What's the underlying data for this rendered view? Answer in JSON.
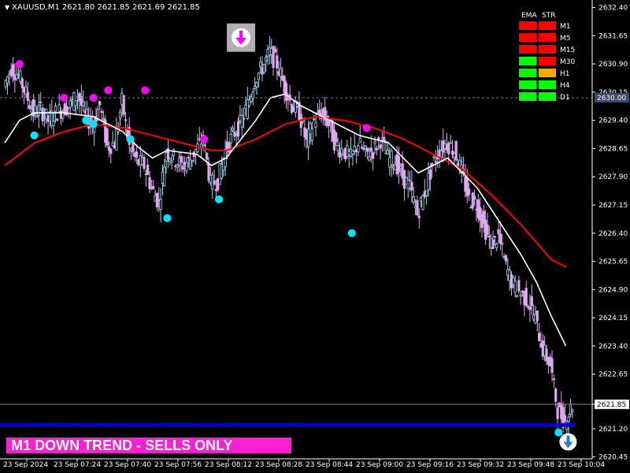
{
  "header": {
    "symbol_timeframe": "XAUUSD,M1",
    "ohlc": "2621.80 2621.85 2621.69 2621.85"
  },
  "banner": {
    "text": "M1  DOWN TREND - SELLS ONLY",
    "color": "#ff1fd2"
  },
  "strength_panel": {
    "headers": [
      "EMA",
      "STR"
    ],
    "rows": [
      {
        "tf": "M1",
        "ema": "#ff0000",
        "str": "#ff0000"
      },
      {
        "tf": "M5",
        "ema": "#ff0000",
        "str": "#ff0000"
      },
      {
        "tf": "M15",
        "ema": "#ff0000",
        "str": "#ff0000"
      },
      {
        "tf": "M30",
        "ema": "#00ff00",
        "str": "#ff0000"
      },
      {
        "tf": "H1",
        "ema": "#00ff00",
        "str": "#ffa500"
      },
      {
        "tf": "H4",
        "ema": "#00ff00",
        "str": "#00ff00"
      },
      {
        "tf": "D1",
        "ema": "#00ff00",
        "str": "#00ff00"
      }
    ]
  },
  "price_tags": {
    "dashed_level": "2630.00",
    "current": "2621.85"
  },
  "colors": {
    "bull_bar": "#a8d8f0",
    "bear_bar": "#e0a8f0",
    "fast_ema": "#ffffff",
    "slow_ema": "#ff0000",
    "swing_high_marker": "#ff00ff",
    "swing_low_marker": "#00e5ff",
    "baseline": "#0000cc",
    "sell_signal_bg": "#b0b0b0",
    "sell_signal_arrow": "#ff00ff"
  },
  "chart_data": {
    "type": "candlestick",
    "ylim": [
      2620.4,
      2632.6
    ],
    "yticks": [
      "2632.40",
      "2631.65",
      "2630.90",
      "2630.15",
      "2629.40",
      "2628.65",
      "2627.90",
      "2627.15",
      "2626.40",
      "2625.65",
      "2624.90",
      "2624.15",
      "2623.40",
      "2622.65",
      "2621.85",
      "2621.20",
      "2620.45"
    ],
    "xticks": [
      "23 Sep 2024",
      "23 Sep 07:24",
      "23 Sep 07:40",
      "23 Sep 07:56",
      "23 Sep 08:12",
      "23 Sep 08:28",
      "23 Sep 08:44",
      "23 Sep 09:00",
      "23 Sep 09:16",
      "23 Sep 09:32",
      "23 Sep 09:48",
      "23 Sep 10:04"
    ],
    "dashed_level": 2630.0,
    "current_price": 2621.85,
    "baseline_level": 2621.3,
    "close_path": [
      [
        0,
        2630.3
      ],
      [
        1,
        2630.8
      ],
      [
        2,
        2630.6
      ],
      [
        3,
        2630.1
      ],
      [
        4,
        2629.6
      ],
      [
        5,
        2629.7
      ],
      [
        6,
        2629.4
      ],
      [
        7,
        2629.6
      ],
      [
        8,
        2629.7
      ],
      [
        9,
        2629.8
      ],
      [
        10,
        2630.1
      ],
      [
        11,
        2629.5
      ],
      [
        12,
        2629.3
      ],
      [
        13,
        2629.8
      ],
      [
        14,
        2628.7
      ],
      [
        15,
        2628.8
      ],
      [
        16,
        2629.9
      ],
      [
        17,
        2628.7
      ],
      [
        18,
        2628.3
      ],
      [
        19,
        2628.2
      ],
      [
        20,
        2627.6
      ],
      [
        21,
        2627.2
      ],
      [
        22,
        2628.6
      ],
      [
        23,
        2628.4
      ],
      [
        24,
        2628.2
      ],
      [
        25,
        2628.3
      ],
      [
        26,
        2628.6
      ],
      [
        27,
        2628.9
      ],
      [
        28,
        2627.7
      ],
      [
        29,
        2627.8
      ],
      [
        30,
        2628.6
      ],
      [
        31,
        2629.0
      ],
      [
        32,
        2629.3
      ],
      [
        33,
        2629.8
      ],
      [
        34,
        2630.5
      ],
      [
        35,
        2630.8
      ],
      [
        36,
        2631.2
      ],
      [
        37,
        2630.9
      ],
      [
        38,
        2630.3
      ],
      [
        39,
        2629.8
      ],
      [
        40,
        2629.6
      ],
      [
        41,
        2628.8
      ],
      [
        42,
        2629.4
      ],
      [
        43,
        2629.6
      ],
      [
        44,
        2629.3
      ],
      [
        45,
        2628.7
      ],
      [
        46,
        2628.6
      ],
      [
        47,
        2628.4
      ],
      [
        48,
        2628.8
      ],
      [
        49,
        2628.5
      ],
      [
        50,
        2628.6
      ],
      [
        51,
        2628.9
      ],
      [
        52,
        2628.4
      ],
      [
        53,
        2628.3
      ],
      [
        54,
        2627.9
      ],
      [
        55,
        2627.6
      ],
      [
        56,
        2626.9
      ],
      [
        57,
        2627.5
      ],
      [
        58,
        2628.2
      ],
      [
        59,
        2628.6
      ],
      [
        60,
        2628.8
      ],
      [
        61,
        2628.6
      ],
      [
        62,
        2628.0
      ],
      [
        63,
        2627.3
      ],
      [
        64,
        2627.2
      ],
      [
        65,
        2626.6
      ],
      [
        66,
        2626.1
      ],
      [
        67,
        2626.3
      ],
      [
        68,
        2625.5
      ],
      [
        69,
        2625.0
      ],
      [
        70,
        2624.8
      ],
      [
        71,
        2624.6
      ],
      [
        72,
        2624.1
      ],
      [
        73,
        2623.3
      ],
      [
        74,
        2622.9
      ],
      [
        75,
        2621.7
      ],
      [
        76,
        2621.4
      ],
      [
        77,
        2621.85
      ]
    ],
    "fast_ema": [
      [
        0,
        2628.8
      ],
      [
        2,
        2629.4
      ],
      [
        4,
        2629.6
      ],
      [
        8,
        2629.6
      ],
      [
        12,
        2629.5
      ],
      [
        14,
        2629.3
      ],
      [
        16,
        2629.1
      ],
      [
        18,
        2628.7
      ],
      [
        20,
        2628.4
      ],
      [
        22,
        2628.6
      ],
      [
        26,
        2628.5
      ],
      [
        28,
        2628.2
      ],
      [
        30,
        2628.4
      ],
      [
        32,
        2628.9
      ],
      [
        34,
        2629.4
      ],
      [
        36,
        2630.0
      ],
      [
        38,
        2630.1
      ],
      [
        40,
        2629.8
      ],
      [
        44,
        2629.4
      ],
      [
        48,
        2629.0
      ],
      [
        50,
        2628.9
      ],
      [
        52,
        2628.8
      ],
      [
        54,
        2628.4
      ],
      [
        56,
        2628.0
      ],
      [
        58,
        2628.2
      ],
      [
        60,
        2628.4
      ],
      [
        62,
        2628.0
      ],
      [
        64,
        2627.6
      ],
      [
        66,
        2627.0
      ],
      [
        68,
        2626.4
      ],
      [
        70,
        2625.8
      ],
      [
        72,
        2625.1
      ],
      [
        74,
        2624.2
      ],
      [
        76,
        2623.4
      ]
    ],
    "slow_ema": [
      [
        0,
        2628.2
      ],
      [
        4,
        2628.8
      ],
      [
        8,
        2629.1
      ],
      [
        12,
        2629.3
      ],
      [
        16,
        2629.2
      ],
      [
        20,
        2629.0
      ],
      [
        24,
        2628.8
      ],
      [
        28,
        2628.6
      ],
      [
        30,
        2628.6
      ],
      [
        34,
        2628.9
      ],
      [
        38,
        2629.3
      ],
      [
        42,
        2629.5
      ],
      [
        46,
        2629.4
      ],
      [
        50,
        2629.2
      ],
      [
        54,
        2628.9
      ],
      [
        58,
        2628.5
      ],
      [
        62,
        2628.1
      ],
      [
        66,
        2627.4
      ],
      [
        70,
        2626.6
      ],
      [
        74,
        2625.7
      ],
      [
        76,
        2625.5
      ]
    ],
    "swing_highs": [
      [
        2,
        2630.9
      ],
      [
        8,
        2630.0
      ],
      [
        12,
        2630.0
      ],
      [
        14,
        2630.2
      ],
      [
        19,
        2630.2
      ],
      [
        27,
        2628.9
      ],
      [
        49,
        2629.2
      ]
    ],
    "swing_lows": [
      [
        4,
        2629.0
      ],
      [
        11,
        2629.4
      ],
      [
        12,
        2629.3
      ],
      [
        17,
        2628.9
      ],
      [
        22,
        2626.8
      ],
      [
        29,
        2627.3
      ],
      [
        47,
        2626.4
      ],
      [
        75,
        2621.1
      ]
    ],
    "sell_signal": {
      "x": 32,
      "y": 2631.6
    }
  }
}
